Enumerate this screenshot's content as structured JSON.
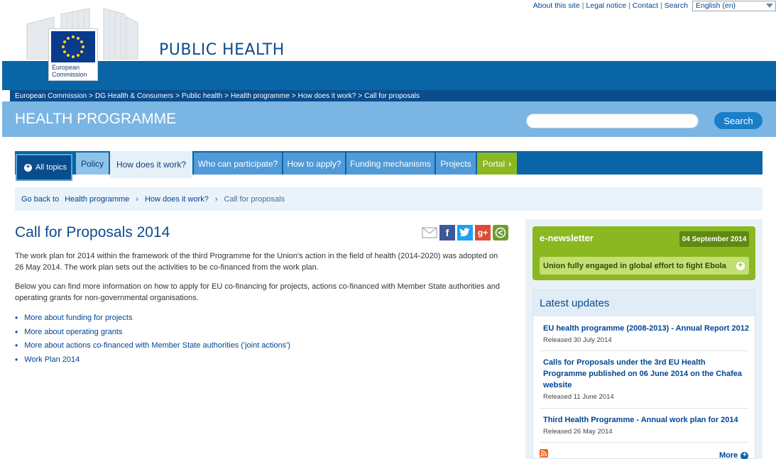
{
  "util_links": [
    "About this site",
    "Legal notice",
    "Contact",
    "Search"
  ],
  "language": "English (en)",
  "logo": {
    "line1": "European",
    "line2": "Commission"
  },
  "site_title": "PUBLIC HEALTH",
  "breadcrumb": [
    "European Commission",
    "DG Health & Consumers",
    "Public health",
    "Health programme",
    "How does it work?",
    "Call for proposals"
  ],
  "program_title": "HEALTH PROGRAMME",
  "search": {
    "value": "",
    "button": "Search"
  },
  "nav": {
    "all_topics": "All topics",
    "tabs": [
      "Policy",
      "How does it work?",
      "Who can participate?",
      "How to apply?",
      "Funding mechanisms",
      "Projects",
      "Portal"
    ]
  },
  "goback": {
    "label": "Go back to",
    "items": [
      "Health programme",
      "How does it work?",
      "Call for proposals"
    ]
  },
  "main": {
    "title": "Call for Proposals 2014",
    "para1": "The work plan for 2014 within the framework of the third Programme for the Union's action in the field of health (2014-2020) was adopted on 26 May 2014. The work plan sets out the activities to be co-financed from the work plan.",
    "para2": "Below you can find more information on how to apply for EU co-financing for projects, actions co-financed with Member State authorities and operating grants for non-governmental organisations.",
    "links": [
      "More about funding for projects",
      "More about operating grants",
      "More about actions co-financed with Member State authorities ('joint actions')",
      "Work Plan 2014"
    ]
  },
  "share_icons": [
    "mail-icon",
    "facebook-icon",
    "twitter-icon",
    "google-plus-icon",
    "share-icon"
  ],
  "enewsletter": {
    "title": "e-newsletter",
    "date": "04 September 2014",
    "item": "Union fully engaged in global effort to fight Ebola"
  },
  "updates": {
    "title": "Latest updates",
    "items": [
      {
        "title": "EU health programme (2008-2013) - Annual Report 2012",
        "date": "Released 30 July 2014"
      },
      {
        "title": "Calls for Proposals under the 3rd EU Health Programme published on 06 June 2014 on the Chafea website",
        "date": "Released 11 June 2014"
      },
      {
        "title": "Third Health Programme - Annual work plan for 2014",
        "date": "Released 26 May 2014"
      }
    ],
    "more": "More"
  },
  "colors": {
    "primary": "#0a65a7",
    "light": "#7ab5e3",
    "green": "#8bb820"
  }
}
